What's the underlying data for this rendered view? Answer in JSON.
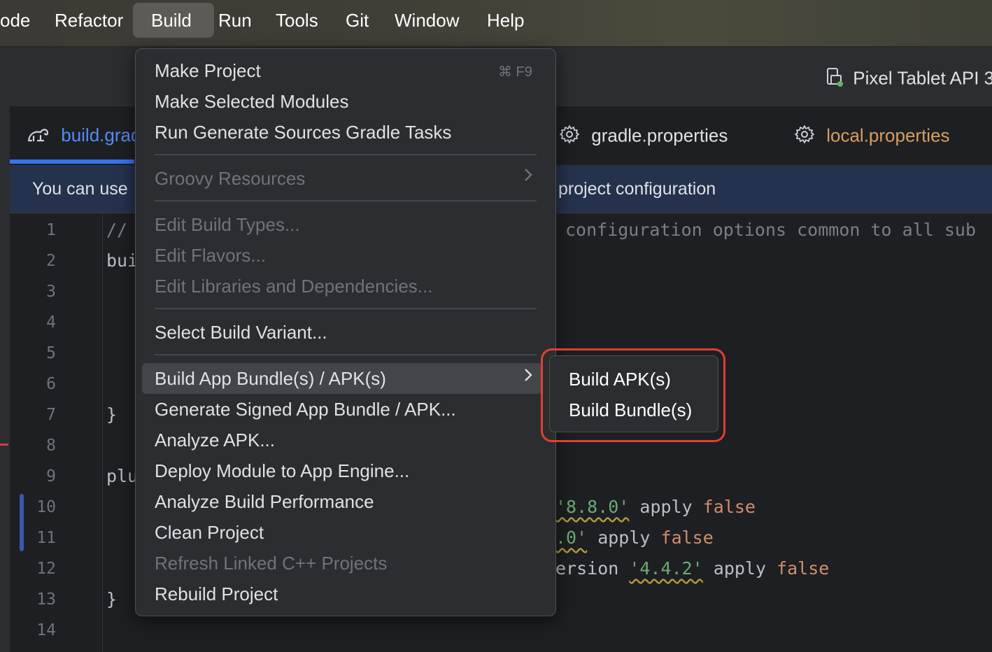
{
  "menubar": {
    "items": [
      "ode",
      "Refactor",
      "Build",
      "Run",
      "Tools",
      "Git",
      "Window",
      "Help"
    ],
    "active": "Build"
  },
  "toolbar": {
    "device_label": "Pixel Tablet API 3",
    "device_icon": "device-icon"
  },
  "tabs": [
    {
      "label": "build.grad",
      "icon": "gradle-icon",
      "color": "#548af7"
    },
    {
      "label": "gradle.properties",
      "icon": "gear-icon",
      "color": "#dfe1e5"
    },
    {
      "label": "local.properties",
      "icon": "gear-icon",
      "color": "#d69e5f"
    }
  ],
  "banner": {
    "left_text": "You can use",
    "right_text": "project configuration"
  },
  "editor": {
    "line_numbers": [
      "1",
      "2",
      "3",
      "4",
      "5",
      "6",
      "7",
      "8",
      "9",
      "10",
      "11",
      "12",
      "13",
      "14"
    ],
    "left_fragments": {
      "l1": "//",
      "l2": "bui",
      "l7": "}",
      "l9": "plu",
      "l13": "}"
    },
    "right_fragments": {
      "l1": "configuration options common to all sub",
      "l10_str": "'8.8.0'",
      "l10_mid": " apply ",
      "l10_kw": "false",
      "l11_str": ".0'",
      "l11_mid": " apply ",
      "l11_kw": "false",
      "l12_pre": "ersion ",
      "l12_str": "'4.4.2'",
      "l12_mid": " apply ",
      "l12_kw": "false"
    }
  },
  "build_menu": {
    "make_project": "Make Project",
    "make_project_shortcut": "⌘ F9",
    "make_selected_modules": "Make Selected Modules",
    "run_generate_sources": "Run Generate Sources Gradle Tasks",
    "groovy_resources": "Groovy Resources",
    "edit_build_types": "Edit Build Types...",
    "edit_flavors": "Edit Flavors...",
    "edit_libraries": "Edit Libraries and Dependencies...",
    "select_build_variant": "Select Build Variant...",
    "build_app_bundle": "Build App Bundle(s) / APK(s)",
    "generate_signed": "Generate Signed App Bundle / APK...",
    "analyze_apk": "Analyze APK...",
    "deploy_module": "Deploy Module to App Engine...",
    "analyze_build_performance": "Analyze Build Performance",
    "clean_project": "Clean Project",
    "refresh_linked_cpp": "Refresh Linked C++ Projects",
    "rebuild_project": "Rebuild Project"
  },
  "submenu": {
    "build_apks": "Build APK(s)",
    "build_bundles": "Build Bundle(s)"
  }
}
